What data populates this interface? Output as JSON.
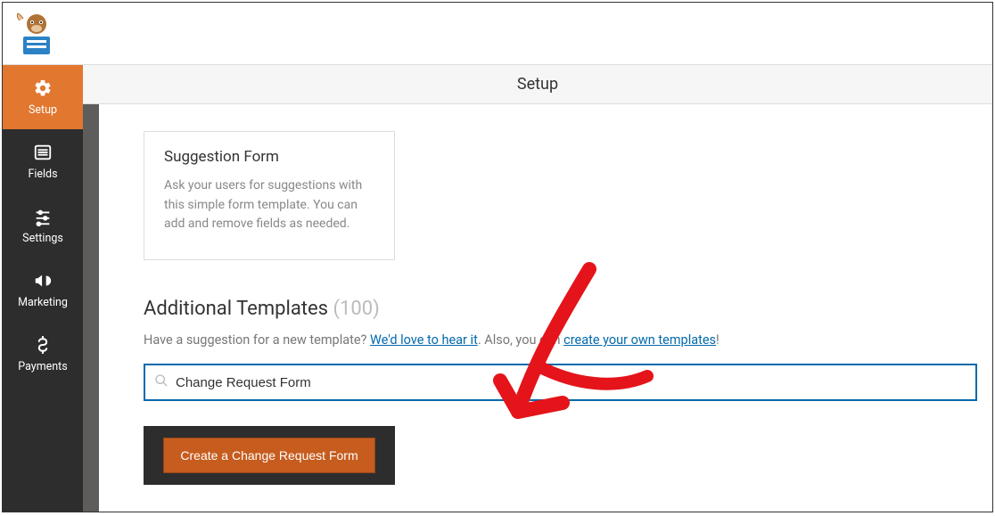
{
  "header": {
    "title": "Setup"
  },
  "sidebar": {
    "items": [
      {
        "label": "Setup"
      },
      {
        "label": "Fields"
      },
      {
        "label": "Settings"
      },
      {
        "label": "Marketing"
      },
      {
        "label": "Payments"
      }
    ]
  },
  "template_card": {
    "title": "Suggestion Form",
    "desc": "Ask your users for suggestions with this simple form template. You can add and remove fields as needed."
  },
  "additional": {
    "title": "Additional Templates",
    "count": "(100)",
    "suggest_prefix": "Have a suggestion for a new template? ",
    "link1": "We'd love to hear it",
    "middle": ". Also, you can ",
    "link2": "create your own templates",
    "suffix": "!"
  },
  "search": {
    "value": "Change Request Form"
  },
  "result": {
    "button_label": "Create a Change Request Form"
  }
}
